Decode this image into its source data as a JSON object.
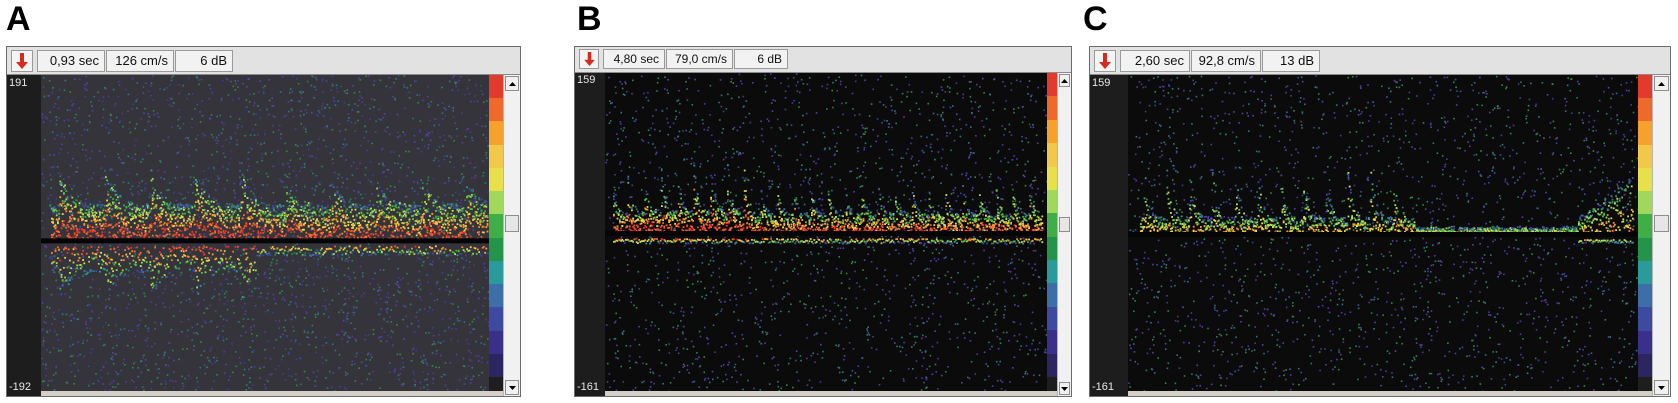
{
  "panels": [
    {
      "letter": "A",
      "readouts": {
        "time": "0,93 sec",
        "velocity": "126 cm/s",
        "gain": "6 dB"
      },
      "scale": {
        "top": "191",
        "bottom": "-192"
      },
      "background": "#34343a",
      "baseline_fraction": 0.52,
      "gain_level": 0.52
    },
    {
      "letter": "B",
      "readouts": {
        "time": "4,80 sec",
        "velocity": "79,0 cm/s",
        "gain": "6 dB"
      },
      "scale": {
        "top": "159",
        "bottom": "-161"
      },
      "background": "#0b0b0c",
      "baseline_fraction": 0.5,
      "gain_level": 0.5
    },
    {
      "letter": "C",
      "readouts": {
        "time": "2,60 sec",
        "velocity": "92,8 cm/s",
        "gain": "13 dB"
      },
      "scale": {
        "top": "159",
        "bottom": "-161"
      },
      "background": "#0b0b0c",
      "baseline_fraction": 0.5,
      "gain_level": 0.51
    }
  ],
  "colors": {
    "record_arrow": "#d62a1e",
    "color_scale": [
      "#e23a2c",
      "#ef6a2a",
      "#f5a12c",
      "#f2c84a",
      "#e8e04a",
      "#9fd85a",
      "#3fae46",
      "#23944a",
      "#2a9a9a",
      "#3c6fa8",
      "#3d4aa0",
      "#3a2f8a",
      "#2b2560"
    ]
  }
}
